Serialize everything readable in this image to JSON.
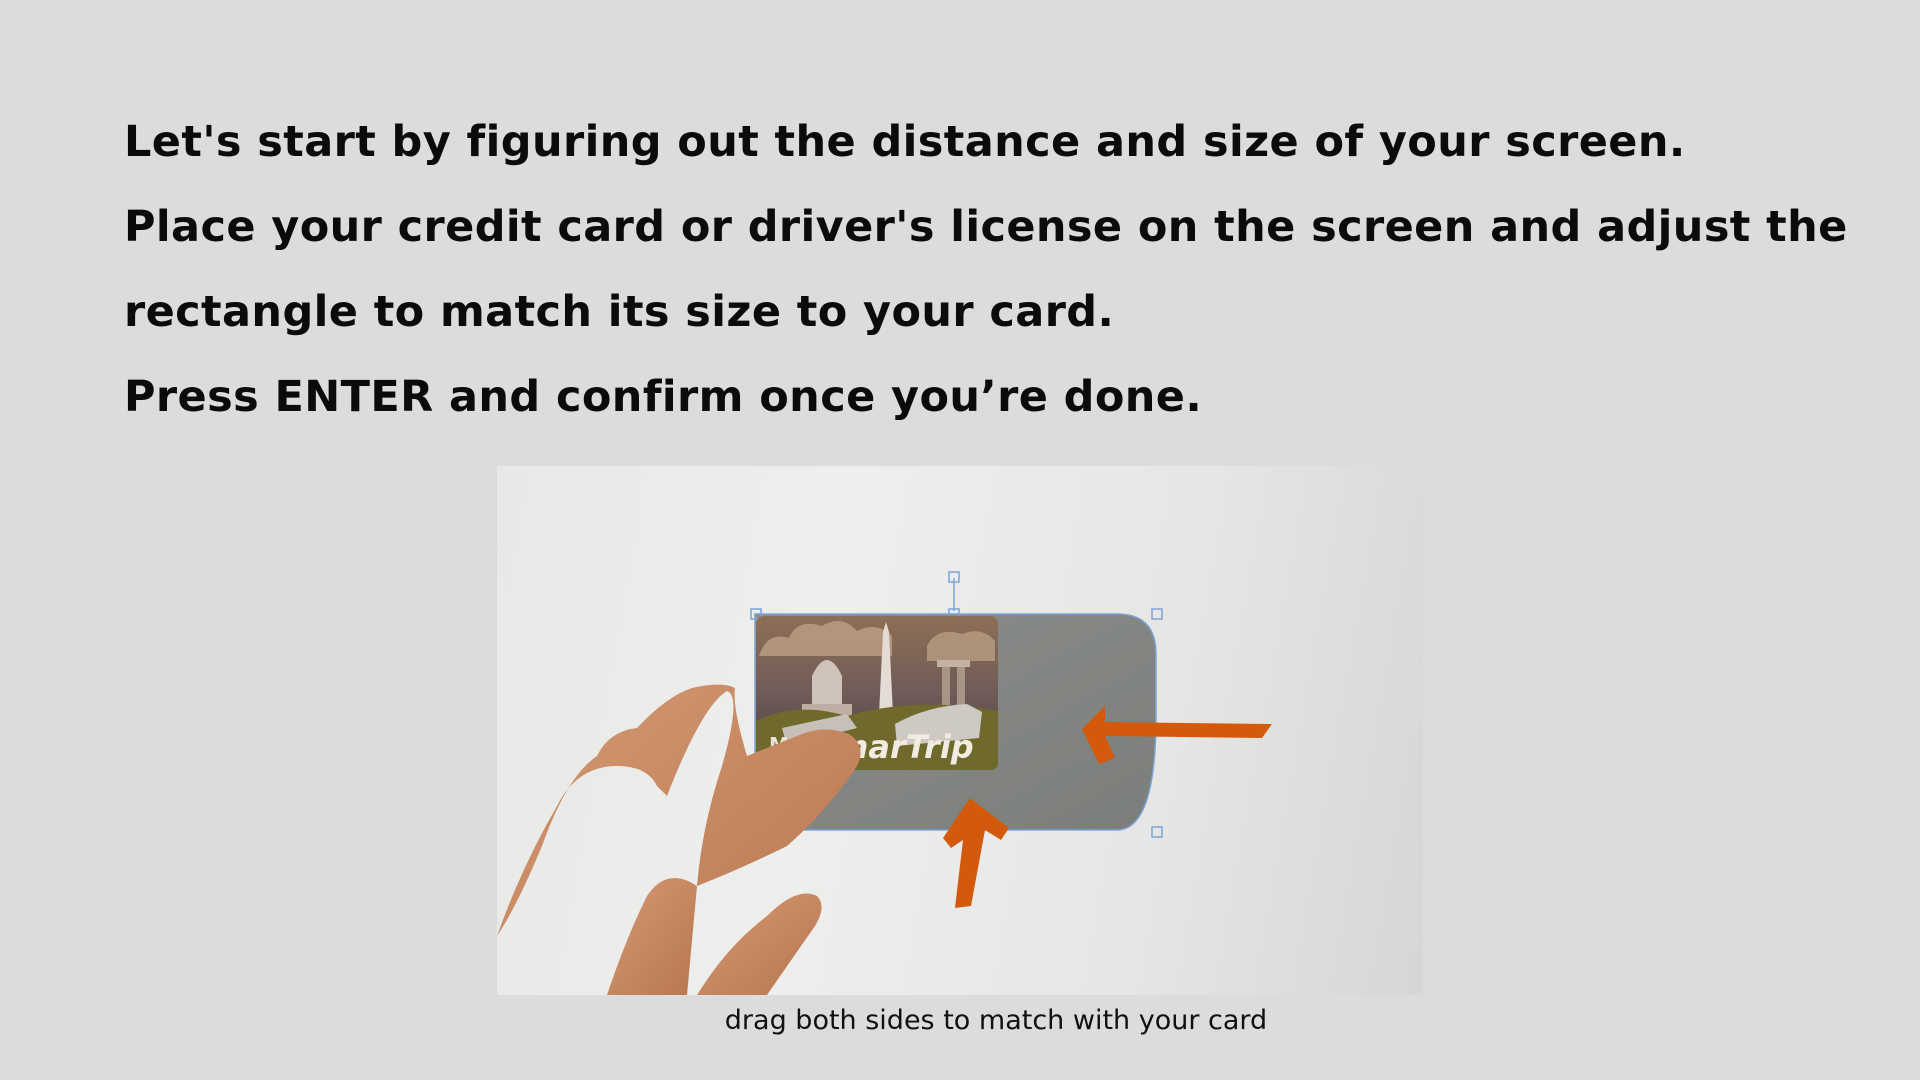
{
  "instructions": {
    "line1": "Let's start by figuring out the distance and size of your screen.",
    "line2": "Place your credit card or driver's license on the screen and adjust the",
    "line3": "rectangle to match its size to your card.",
    "line4": "Press ENTER and confirm once you’re done."
  },
  "illustration": {
    "card_text": "marTrip",
    "card_logo_letter": "M",
    "arrow_color": "#d35a0c"
  },
  "caption": "drag both sides to match with your card"
}
